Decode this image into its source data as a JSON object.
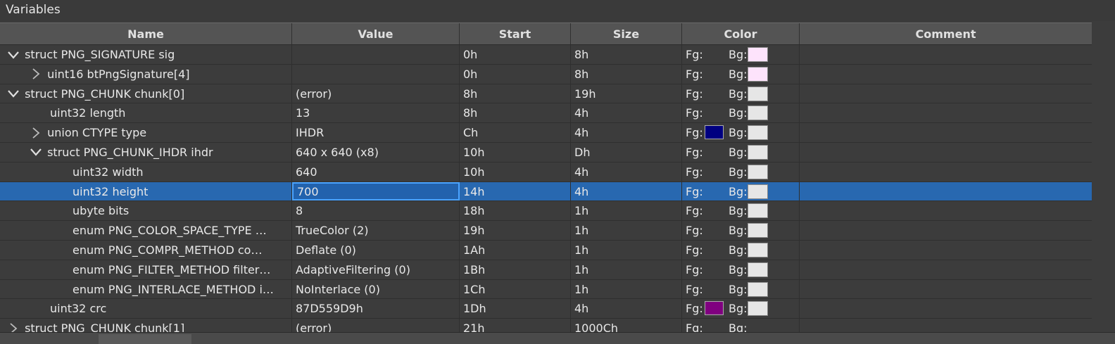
{
  "panel": {
    "title": "Variables"
  },
  "columns": [
    "Name",
    "Value",
    "Start",
    "Size",
    "Color",
    "Comment"
  ],
  "color_labels": {
    "fg": "Fg:",
    "bg": "Bg:"
  },
  "rows": [
    {
      "name": "struct PNG_SIGNATURE sig",
      "value": "",
      "start": "0h",
      "size": "8h",
      "fg": "",
      "bg": "#fde3fb",
      "toggle": "expanded",
      "level": 0
    },
    {
      "name": "uint16 btPngSignature[4]",
      "value": "",
      "start": "0h",
      "size": "8h",
      "fg": "",
      "bg": "#fde3fb",
      "toggle": "collapsed",
      "level": 1
    },
    {
      "name": "struct PNG_CHUNK chunk[0]",
      "value": "(error)",
      "start": "8h",
      "size": "19h",
      "fg": "",
      "bg": "#e6e6e6",
      "toggle": "expanded",
      "level": 0
    },
    {
      "name": "uint32 length",
      "value": "13",
      "start": "8h",
      "size": "4h",
      "fg": "",
      "bg": "#e6e6e6",
      "toggle": "none",
      "level": 1
    },
    {
      "name": "union CTYPE type",
      "value": "IHDR",
      "start": "Ch",
      "size": "4h",
      "fg": "#000080",
      "bg": "#e6e6e6",
      "toggle": "collapsed",
      "level": 1
    },
    {
      "name": "struct PNG_CHUNK_IHDR ihdr",
      "value": "640 x 640 (x8)",
      "start": "10h",
      "size": "Dh",
      "fg": "",
      "bg": "#e6e6e6",
      "toggle": "expanded",
      "level": 1
    },
    {
      "name": "uint32 width",
      "value": "640",
      "start": "10h",
      "size": "4h",
      "fg": "",
      "bg": "#e6e6e6",
      "toggle": "none",
      "level": 2
    },
    {
      "name": "uint32 height",
      "value": "700",
      "start": "14h",
      "size": "4h",
      "fg": "",
      "bg": "#e6e6e6",
      "toggle": "none",
      "level": 2,
      "selected": true
    },
    {
      "name": "ubyte bits",
      "value": "8",
      "start": "18h",
      "size": "1h",
      "fg": "",
      "bg": "#e6e6e6",
      "toggle": "none",
      "level": 2
    },
    {
      "name": "enum PNG_COLOR_SPACE_TYPE …",
      "value": "TrueColor (2)",
      "start": "19h",
      "size": "1h",
      "fg": "",
      "bg": "#e6e6e6",
      "toggle": "none",
      "level": 2
    },
    {
      "name": "enum PNG_COMPR_METHOD co…",
      "value": "Deflate (0)",
      "start": "1Ah",
      "size": "1h",
      "fg": "",
      "bg": "#e6e6e6",
      "toggle": "none",
      "level": 2
    },
    {
      "name": "enum PNG_FILTER_METHOD filter…",
      "value": "AdaptiveFiltering (0)",
      "start": "1Bh",
      "size": "1h",
      "fg": "",
      "bg": "#e6e6e6",
      "toggle": "none",
      "level": 2
    },
    {
      "name": "enum PNG_INTERLACE_METHOD i…",
      "value": "NoInterlace (0)",
      "start": "1Ch",
      "size": "1h",
      "fg": "",
      "bg": "#e6e6e6",
      "toggle": "none",
      "level": 2
    },
    {
      "name": "uint32 crc",
      "value": "87D559D9h",
      "start": "1Dh",
      "size": "4h",
      "fg": "#800080",
      "bg": "#e6e6e6",
      "toggle": "none",
      "level": 1
    },
    {
      "name": "struct PNG_CHUNK chunk[1]",
      "value": "(error)",
      "start": "21h",
      "size": "1000Ch",
      "fg": "",
      "bg": "",
      "toggle": "collapsed",
      "level": 0
    }
  ]
}
